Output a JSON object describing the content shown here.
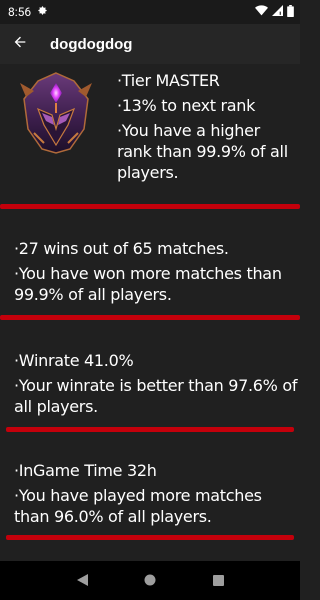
{
  "status_bar": {
    "time": "8:56",
    "icons": [
      "settings-gear-icon",
      "wifi-icon",
      "cell-signal-icon",
      "battery-icon"
    ]
  },
  "app_bar": {
    "title": "dogdogdog",
    "back_icon": "arrow-back-icon"
  },
  "rank_card": {
    "emblem_icon": "master-rank-emblem",
    "lines": [
      "·Tier MASTER",
      "·13% to next rank",
      "·You have a higher rank than 99.9% of all players."
    ]
  },
  "wins_card": {
    "lines": [
      "·27 wins out of 65 matches.",
      "·You have won more matches than 99.9% of all players."
    ]
  },
  "winrate_card": {
    "lines": [
      "·Winrate 41.0%",
      "·Your winrate is better than 97.6% of all players."
    ]
  },
  "ingame_card": {
    "lines": [
      "·InGame Time 32h",
      "·You have played more matches than 96.0% of all players."
    ]
  },
  "nav_bar": {
    "buttons": [
      "back-triangle-icon",
      "home-circle-icon",
      "recents-square-icon"
    ]
  },
  "colors": {
    "background": "#202020",
    "app_bar": "#262626",
    "divider": "#c4000b",
    "text": "#ffffff"
  }
}
